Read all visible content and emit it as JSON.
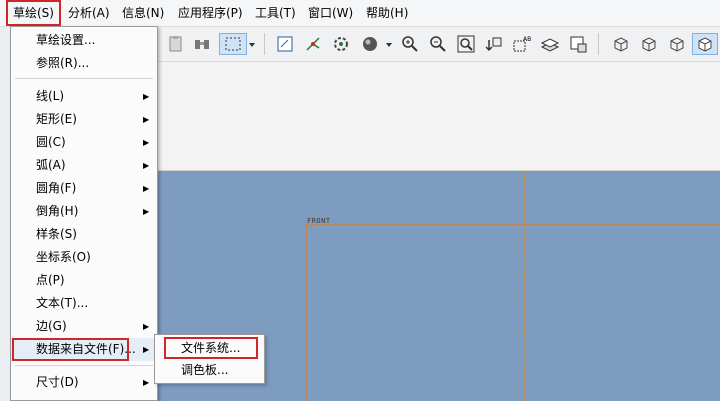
{
  "menubar": {
    "items": [
      {
        "label": "草绘(S)",
        "active": true
      },
      {
        "label": "分析(A)"
      },
      {
        "label": "信息(N)"
      },
      {
        "label": "应用程序(P)"
      },
      {
        "label": "工具(T)"
      },
      {
        "label": "窗口(W)"
      },
      {
        "label": "帮助(H)"
      }
    ]
  },
  "toolbar": {
    "icons": [
      "paste-icon",
      "binoculars-icon",
      "select-box-icon",
      "dropdown-arrow-icon",
      "sketch-view-icon",
      "datum-axes-icon",
      "gear-plane-icon",
      "sphere-icon",
      "dropdown-arrow-icon",
      "zoom-in-icon",
      "zoom-out-icon",
      "zoom-fit-icon",
      "orient-icon",
      "text-ab-icon",
      "layers-icon",
      "saved-view-icon",
      "cube-icon",
      "cube-icon",
      "cube-icon",
      "cube-shaded-icon"
    ]
  },
  "canvas": {
    "background": "#7e9cc0",
    "plane_label": "FRONT"
  },
  "sketch_menu": {
    "items": [
      {
        "label": "草绘设置...",
        "submenu": false
      },
      {
        "label": "参照(R)...",
        "submenu": false
      },
      {
        "label": "线(L)",
        "submenu": true
      },
      {
        "label": "矩形(E)",
        "submenu": true
      },
      {
        "label": "圆(C)",
        "submenu": true
      },
      {
        "label": "弧(A)",
        "submenu": true
      },
      {
        "label": "圆角(F)",
        "submenu": true
      },
      {
        "label": "倒角(H)",
        "submenu": true
      },
      {
        "label": "样条(S)",
        "submenu": false
      },
      {
        "label": "坐标系(O)",
        "submenu": false
      },
      {
        "label": "点(P)",
        "submenu": false
      },
      {
        "label": "文本(T)...",
        "submenu": false
      },
      {
        "label": "边(G)",
        "submenu": true
      },
      {
        "label": "数据来自文件(F)...",
        "submenu": true,
        "highlighted": true
      },
      {
        "label": "尺寸(D)",
        "submenu": true
      }
    ]
  },
  "data_from_file_submenu": {
    "items": [
      {
        "label": "文件系统...",
        "highlighted": true
      },
      {
        "label": "调色板..."
      }
    ]
  }
}
